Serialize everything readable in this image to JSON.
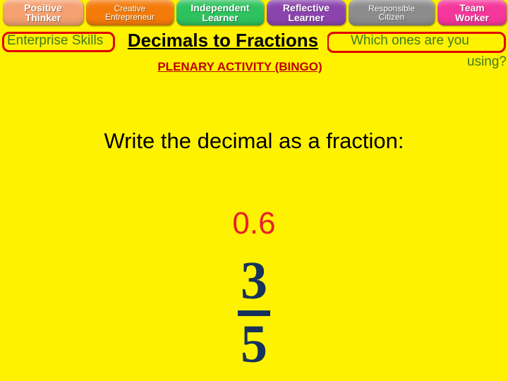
{
  "slide": {
    "background_color": "#FFF200"
  },
  "skill_banner": {
    "chips": [
      {
        "line1": "Positive",
        "line2": "Thinker",
        "color": "#F4A070"
      },
      {
        "line1": "Creative",
        "line2": "Entrepreneur",
        "color": "#F47B0A"
      },
      {
        "line1": "Independent",
        "line2": "Learner",
        "color": "#2EC25E"
      },
      {
        "line1": "Reflective",
        "line2": "Learner",
        "color": "#8B44AD"
      },
      {
        "line1": "Responsible",
        "line2": "Citizen",
        "color": "#8C8C8C"
      },
      {
        "line1": "Team",
        "line2": "Worker",
        "color": "#F5369B"
      }
    ]
  },
  "callouts": {
    "enterprise_label": "Enterprise Skills",
    "which_label": "Which ones are you",
    "using_label": "using?",
    "border_color": "#E00000",
    "text_color": "#3F7A1E"
  },
  "titles": {
    "main": "Decimals to Fractions",
    "plenary": "PLENARY ACTIVITY (BINGO)",
    "main_color": "#000000",
    "plenary_color": "#C00000"
  },
  "question": {
    "prompt": "Write the decimal as a fraction:",
    "decimal": "0.6",
    "decimal_color": "#E8202A",
    "answer": {
      "numerator": "3",
      "denominator": "5",
      "color": "#16325C"
    }
  }
}
